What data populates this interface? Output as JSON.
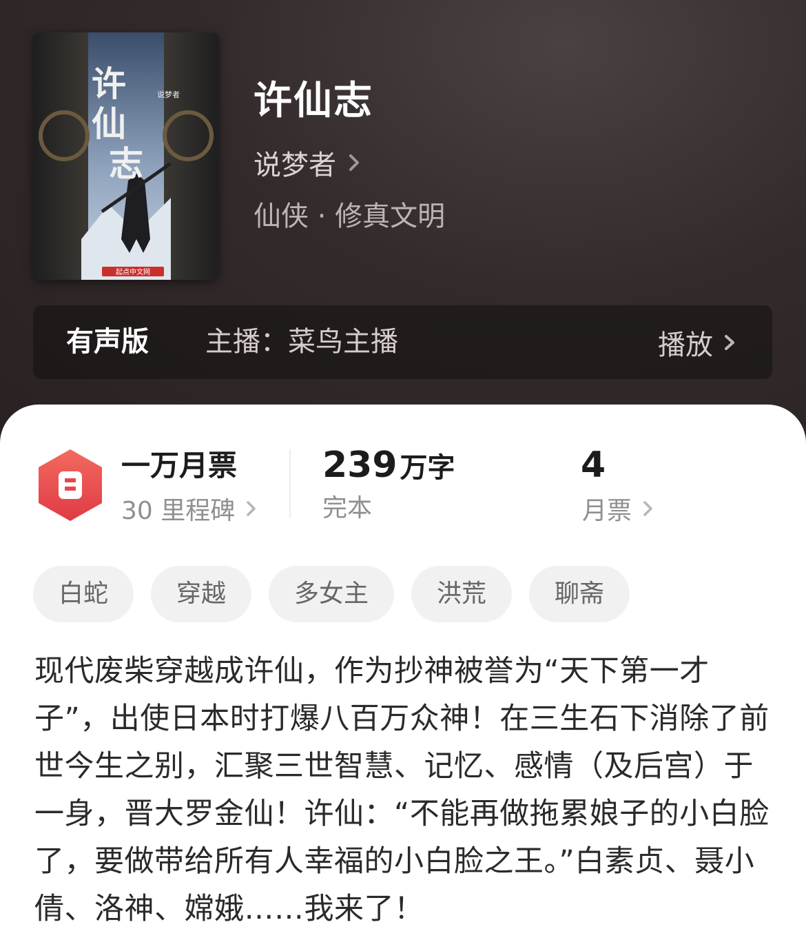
{
  "book": {
    "title": "许仙志",
    "author": "说梦者",
    "genre": "仙侠 · 修真文明",
    "cover": {
      "title_text": "许仙志",
      "author_text": "说梦者",
      "publisher_text": "起点中文网"
    }
  },
  "audio": {
    "label": "有声版",
    "anchor": "主播：菜鸟主播",
    "play_label": "播放"
  },
  "stats": {
    "badge_title": "一万月票",
    "badge_sub": "30 里程碑",
    "words_number": "239",
    "words_unit": "万字",
    "status": "完本",
    "tickets_count": "4",
    "tickets_label": "月票"
  },
  "tags": [
    "白蛇",
    "穿越",
    "多女主",
    "洪荒",
    "聊斋"
  ],
  "description": "现代废柴穿越成许仙，作为抄神被誉为“天下第一才子”，出使日本时打爆八百万众神！在三生石下消除了前世今生之别，汇聚三世智慧、记忆、感情（及后宫）于一身，晋大罗金仙！许仙：“不能再做拖累娘子的小白脸了，要做带给所有人幸福的小白脸之王。”白素贞、聂小倩、洛神、嫦娥……我来了！",
  "colors": {
    "header_bg": "#332b2b",
    "badge_red": "#e8474a",
    "tag_bg": "#f1f1f1"
  }
}
